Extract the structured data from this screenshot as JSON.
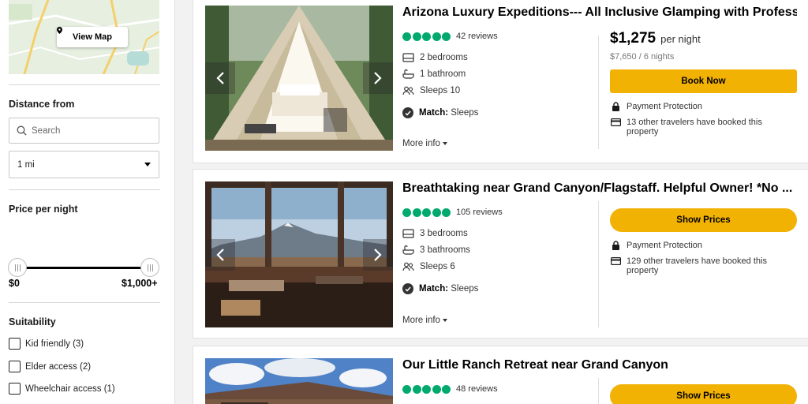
{
  "sidebar": {
    "view_map": "View Map",
    "distance_title": "Distance from",
    "search_placeholder": "Search",
    "distance_value": "1 mi",
    "price_title": "Price per night",
    "price_min": "$0",
    "price_max": "$1,000+",
    "suitability_title": "Suitability",
    "suitability": [
      {
        "label": "Kid friendly (3)"
      },
      {
        "label": "Elder access (2)"
      },
      {
        "label": "Wheelchair access (1)"
      }
    ]
  },
  "listings": [
    {
      "title": "Arizona Luxury Expeditions--- All Inclusive Glamping with Professi...",
      "reviews": "42 reviews",
      "features": [
        "2 bedrooms",
        "1 bathroom",
        "Sleeps 10"
      ],
      "match_label": "Match:",
      "match_value": "Sleeps",
      "more_info": "More info",
      "price": "$1,275",
      "price_per": "per night",
      "price_total": "$7,650 / 6 nights",
      "cta": "Book Now",
      "perk1": "Payment Protection",
      "perk2": "13 other travelers have booked this property"
    },
    {
      "title": "Breathtaking near Grand Canyon/Flagstaff. Helpful Owner! *No ...",
      "reviews": "105 reviews",
      "features": [
        "3 bedrooms",
        "3 bathrooms",
        "Sleeps 6"
      ],
      "match_label": "Match:",
      "match_value": "Sleeps",
      "more_info": "More info",
      "cta": "Show Prices",
      "perk1": "Payment Protection",
      "perk2": "129 other travelers have booked this property"
    },
    {
      "title": "Our Little Ranch Retreat near Grand Canyon",
      "reviews": "48 reviews",
      "cta": "Show Prices"
    }
  ],
  "colors": {
    "accent_button": "#f2b203",
    "rating_bubble": "#00aa6c"
  }
}
